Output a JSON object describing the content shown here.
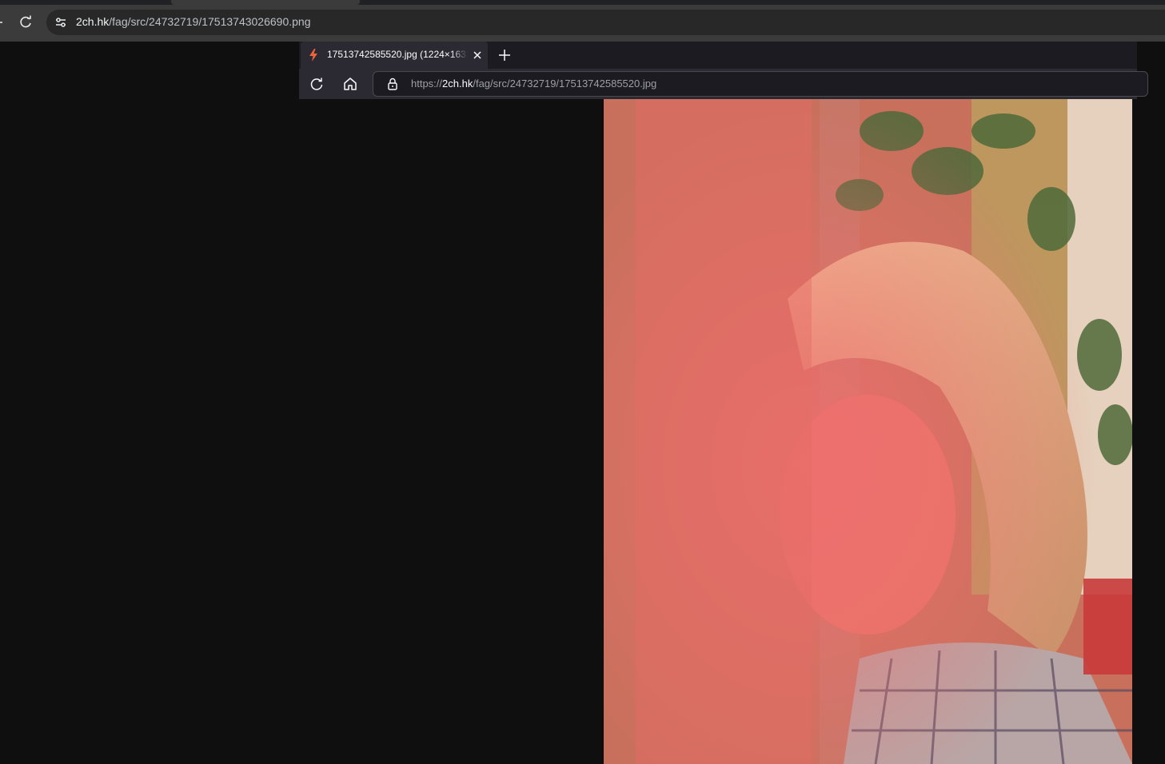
{
  "outer_browser": {
    "url_host": "2ch.hk",
    "url_path": "/fag/src/24732719/17513743026690.png"
  },
  "inner_browser": {
    "tab_title": "17513742585520.jpg (1224×1632",
    "url_scheme": "https://",
    "url_host": "2ch.hk",
    "url_path": "/fag/src/24732719/17513742585520.jpg"
  },
  "image": {
    "description_name": "photo-of-person-with-blonde-hair"
  },
  "colors": {
    "outer_chrome_bg": "#3b3b3b",
    "inner_toolbar_bg": "#2b2a33",
    "page_bg": "#0f0f10",
    "favicon_accent": "#f0643c"
  }
}
